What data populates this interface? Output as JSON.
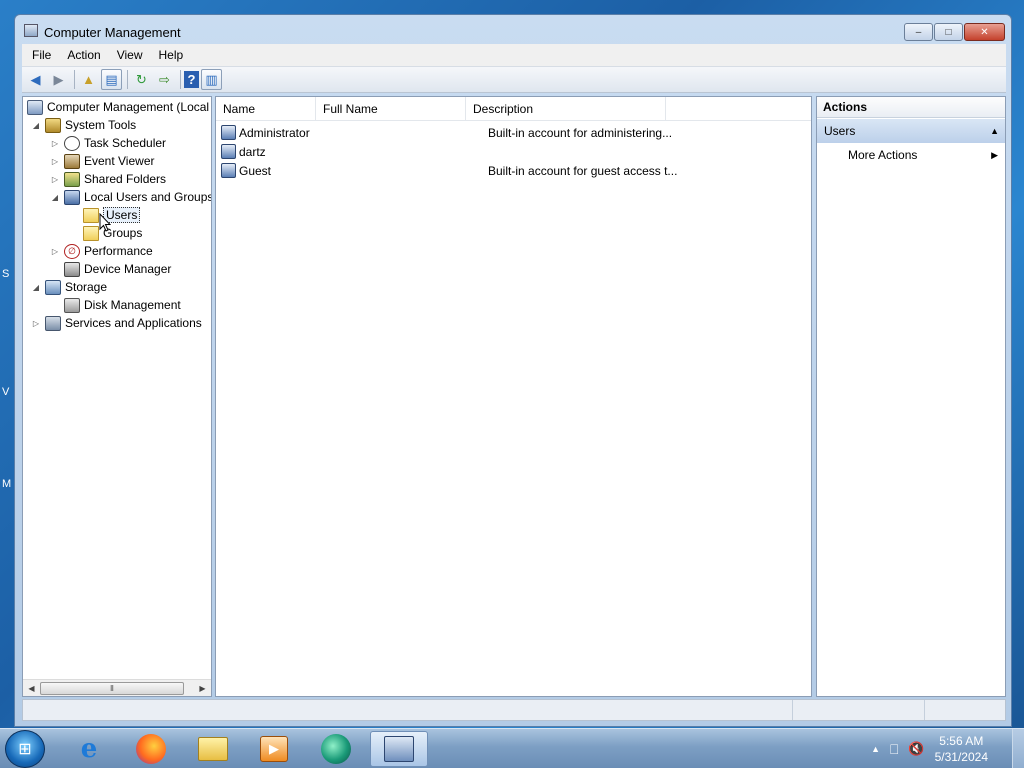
{
  "window": {
    "title": "Computer Management"
  },
  "menu": [
    "File",
    "Action",
    "View",
    "Help"
  ],
  "tree": {
    "root": "Computer Management (Local",
    "system_tools": "System Tools",
    "task_scheduler": "Task Scheduler",
    "event_viewer": "Event Viewer",
    "shared_folders": "Shared Folders",
    "local_users_groups": "Local Users and Groups",
    "users": "Users",
    "groups": "Groups",
    "performance": "Performance",
    "device_manager": "Device Manager",
    "storage": "Storage",
    "disk_management": "Disk Management",
    "services_apps": "Services and Applications"
  },
  "list": {
    "columns": [
      "Name",
      "Full Name",
      "Description"
    ],
    "rows": [
      {
        "name": "Administrator",
        "full_name": "",
        "description": "Built-in account for administering..."
      },
      {
        "name": "dartz",
        "full_name": "",
        "description": ""
      },
      {
        "name": "Guest",
        "full_name": "",
        "description": "Built-in account for guest access t..."
      }
    ]
  },
  "actions": {
    "title": "Actions",
    "section": "Users",
    "item": "More Actions"
  },
  "taskbar": {
    "time": "5:56 AM",
    "date": "5/31/2024"
  },
  "icons": {
    "back": "back-arrow-icon",
    "forward": "forward-arrow-icon",
    "up": "up-folder-icon",
    "show_hide_tree": "console-tree-icon",
    "refresh": "refresh-icon",
    "export": "export-list-icon",
    "help": "help-icon",
    "show_hide_action": "action-pane-icon"
  },
  "colors": {
    "window_frame": "#b3cbe6",
    "selection": "#e8f1fb",
    "close_button": "#c4412c"
  }
}
